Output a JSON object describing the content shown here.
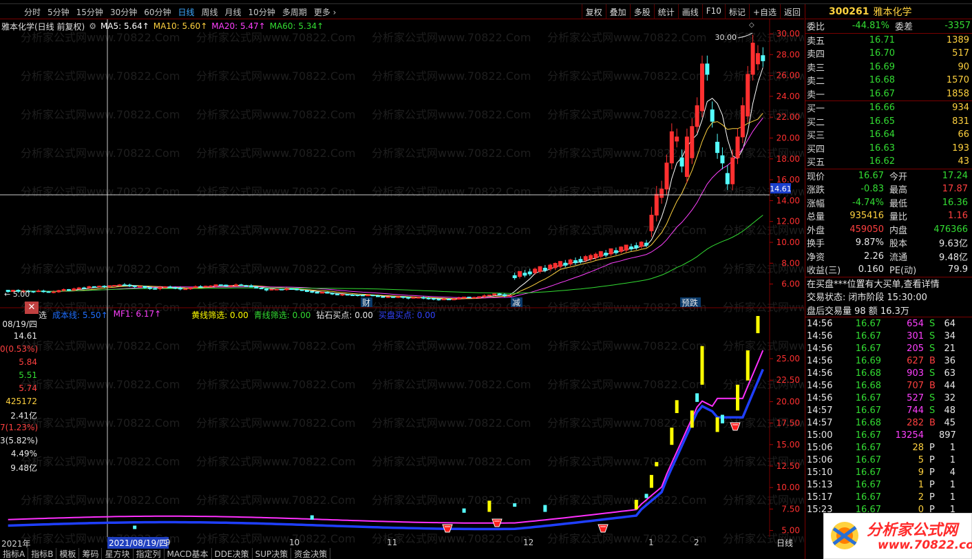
{
  "period_tabs": [
    "分时",
    "5分钟",
    "15分钟",
    "30分钟",
    "60分钟",
    "日线",
    "周线",
    "月线",
    "10分钟",
    "多周期",
    "更多 ›"
  ],
  "active_period": "日线",
  "toolbar_buttons": [
    "复权",
    "叠加",
    "多股",
    "统计",
    "画线",
    "F10",
    "标记",
    "+自选",
    "返回"
  ],
  "main_legend": {
    "title": "雅本化学(日线 前复权)",
    "ma5": "MA5: 5.64↑",
    "ma10": "MA10: 5.60↑",
    "ma20": "MA20: 5.47↑",
    "ma60": "MA60: 5.34↑"
  },
  "colors": {
    "up": "#ff3030",
    "down": "#55ffff",
    "ma5": "#ffffff",
    "ma10": "#ffd23f",
    "ma20": "#ff40ff",
    "ma60": "#33dd33",
    "grid": "#7a0000",
    "indicator_blue": "#1f3fff",
    "indicator_magenta": "#ff30ff",
    "yellow_bar": "#ffff00"
  },
  "price_axis": [
    "30.00",
    "28.00",
    "26.00",
    "24.00",
    "22.00",
    "20.00",
    "18.00",
    "16.00",
    "14.00",
    "12.00",
    "10.00",
    "8.00",
    "6.00"
  ],
  "crosshair_price": "14.61",
  "high_marker": "30.00",
  "low_marker": "5.00",
  "event_markers": [
    "财",
    "减",
    "预跌"
  ],
  "indicator_legend": {
    "prefix": "选",
    "cost": "成本线: 5.50↑",
    "mf1": "MF1: 6.17↑",
    "yellow": "黄线筛选: 0.00",
    "cyan": "青线筛选: 0.00",
    "diamond": "钻石买点: 0.00",
    "hidden": "买盘买点: 0.00"
  },
  "indicator_axis": [
    "25.00",
    "22.50",
    "20.00",
    "17.50",
    "15.00",
    "12.50",
    "10.00",
    "7.50",
    "5.00"
  ],
  "data_window": [
    "08/19/四",
    "14.61",
    "0(0.53%)",
    "5.84",
    "5.51",
    "5.74",
    "425172",
    "2.41亿",
    "7(1.23%)",
    "3(5.82%)",
    "4.49%",
    "9.48亿"
  ],
  "time_axis": {
    "year": "2021年",
    "cursor_date": "2021/08/19/四",
    "months": [
      "9",
      "10",
      "11",
      "12",
      "1",
      "2"
    ]
  },
  "bottom_tabs": [
    "指标A",
    "指标B",
    "模板",
    "筹码",
    "星方块",
    "指定列",
    "MACD基本",
    "DDE决策",
    "SUP决策",
    "资金决策"
  ],
  "bottom_right": "日线",
  "quote": {
    "code": "300261",
    "name": "雅本化学",
    "webi_label": "委比",
    "webi": "-44.81%",
    "weicha_label": "委差",
    "weicha": "-3357",
    "asks": [
      {
        "label": "卖五",
        "price": "16.71",
        "vol": "1389"
      },
      {
        "label": "卖四",
        "price": "16.70",
        "vol": "517"
      },
      {
        "label": "卖三",
        "price": "16.69",
        "vol": "90"
      },
      {
        "label": "卖二",
        "price": "16.68",
        "vol": "1570"
      },
      {
        "label": "卖一",
        "price": "16.67",
        "vol": "1858"
      }
    ],
    "bids": [
      {
        "label": "买一",
        "price": "16.66",
        "vol": "934"
      },
      {
        "label": "买二",
        "price": "16.65",
        "vol": "831"
      },
      {
        "label": "买三",
        "price": "16.64",
        "vol": "66"
      },
      {
        "label": "买四",
        "price": "16.63",
        "vol": "193"
      },
      {
        "label": "买五",
        "price": "16.62",
        "vol": "43"
      }
    ],
    "stats": [
      {
        "l1": "现价",
        "v1": "16.67",
        "c1": "green",
        "l2": "今开",
        "v2": "17.24",
        "c2": "green"
      },
      {
        "l1": "涨跌",
        "v1": "-0.83",
        "c1": "green",
        "l2": "最高",
        "v2": "17.87",
        "c2": "red"
      },
      {
        "l1": "涨幅",
        "v1": "-4.74%",
        "c1": "green",
        "l2": "最低",
        "v2": "16.36",
        "c2": "green"
      },
      {
        "l1": "总量",
        "v1": "935416",
        "c1": "yellow",
        "l2": "量比",
        "v2": "1.16",
        "c2": "red"
      },
      {
        "l1": "外盘",
        "v1": "459050",
        "c1": "red",
        "l2": "内盘",
        "v2": "476366",
        "c2": "green"
      },
      {
        "l1": "换手",
        "v1": "9.87%",
        "c1": "white",
        "l2": "股本",
        "v2": "9.63亿",
        "c2": "white"
      },
      {
        "l1": "净资",
        "v1": "2.26",
        "c1": "white",
        "l2": "流通",
        "v2": "9.48亿",
        "c2": "white"
      },
      {
        "l1": "收益(三)",
        "v1": "0.160",
        "c1": "white",
        "l2": "PE(动)",
        "v2": "79.9",
        "c2": "white"
      }
    ],
    "notice": "在买盘***位置有大买单,查看详情",
    "status_label": "交易状态:",
    "status_value": "闭市阶段 15:30:00",
    "after_hours": "盘后交易量 98 额 16.3万"
  },
  "ticks": [
    {
      "t": "14:56",
      "p": "16.67",
      "v": "654",
      "d": "S",
      "n": "64"
    },
    {
      "t": "14:56",
      "p": "16.67",
      "v": "301",
      "d": "S",
      "n": "34"
    },
    {
      "t": "14:56",
      "p": "16.67",
      "v": "205",
      "d": "S",
      "n": "21"
    },
    {
      "t": "14:56",
      "p": "16.69",
      "v": "627",
      "d": "B",
      "n": "36"
    },
    {
      "t": "14:56",
      "p": "16.68",
      "v": "903",
      "d": "S",
      "n": "63"
    },
    {
      "t": "14:56",
      "p": "16.68",
      "v": "707",
      "d": "B",
      "n": "44"
    },
    {
      "t": "14:56",
      "p": "16.67",
      "v": "527",
      "d": "S",
      "n": "32"
    },
    {
      "t": "14:57",
      "p": "16.67",
      "v": "744",
      "d": "S",
      "n": "48"
    },
    {
      "t": "14:57",
      "p": "16.68",
      "v": "282",
      "d": "B",
      "n": "45"
    },
    {
      "t": "15:00",
      "p": "16.67",
      "v": "13254",
      "d": "",
      "n": "897"
    },
    {
      "t": "15:06",
      "p": "16.67",
      "v": "28",
      "d": "P",
      "n": "1"
    },
    {
      "t": "15:06",
      "p": "16.67",
      "v": "5",
      "p2": "",
      "d": "P",
      "n": "1"
    },
    {
      "t": "15:10",
      "p": "16.67",
      "v": "9",
      "d": "P",
      "n": "4"
    },
    {
      "t": "15:13",
      "p": "16.67",
      "v": "1",
      "d": "P",
      "n": "1"
    },
    {
      "t": "15:17",
      "p": "16.67",
      "v": "2",
      "d": "P",
      "n": "1"
    },
    {
      "t": "15:23",
      "p": "16.67",
      "v": "0",
      "d": "P",
      "n": "1"
    }
  ],
  "watermark": "分析家公式网www.70822.Com",
  "logo_text": "分析家公式网",
  "logo_url": "www.70822.com"
}
